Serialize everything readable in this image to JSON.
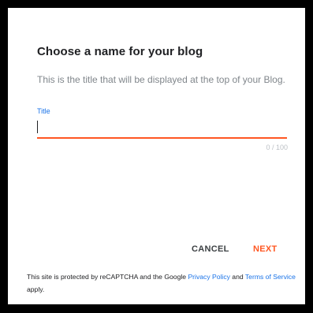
{
  "dialog": {
    "title": "Choose a name for your blog",
    "subtitle": "This is the title that will be displayed at the top of your Blog.",
    "field": {
      "label": "Title",
      "value": "",
      "counter": "0 / 100"
    },
    "buttons": {
      "cancel": "CANCEL",
      "next": "NEXT"
    },
    "footer": {
      "text_before": "This site is protected by reCAPTCHA and the Google ",
      "privacy_link": "Privacy Policy",
      "and_text": " and ",
      "terms_link": "Terms of Service",
      "text_after": " apply."
    }
  },
  "colors": {
    "accent": "#ff5722",
    "link": "#1a73e8",
    "background": "#000000",
    "dialog": "#ffffff"
  }
}
